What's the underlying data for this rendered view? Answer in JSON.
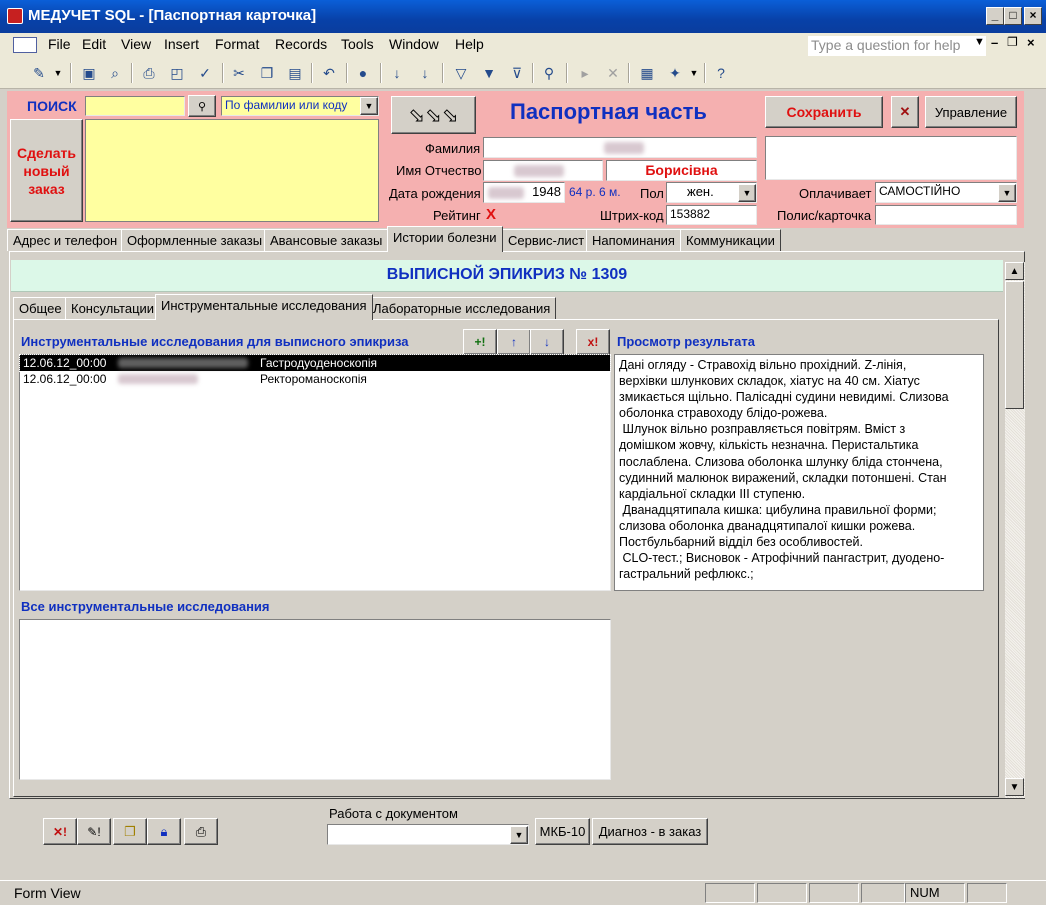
{
  "window": {
    "title": "МЕДУЧЕТ SQL - [Паспортная карточка]"
  },
  "menu": {
    "items": [
      "File",
      "Edit",
      "View",
      "Insert",
      "Format",
      "Records",
      "Tools",
      "Window",
      "Help"
    ],
    "help_placeholder": "Type a question for help"
  },
  "search": {
    "label": "ПОИСК",
    "value": "",
    "mode": "По фамилии или коду"
  },
  "new_order_button": "Сделать новый заказ",
  "header": {
    "title": "Паспортная часть",
    "save": "Сохранить",
    "manage": "Управление"
  },
  "form": {
    "surname_label": "Фамилия",
    "name_label": "Имя Отчество",
    "patronymic": "Борисівна",
    "dob_label": "Дата рождения",
    "dob_year": "1948",
    "age": "64 р. 6 м.",
    "sex_label": "Пол",
    "sex_value": "жен.",
    "payer_label": "Оплачивает",
    "payer_value": "САМОСТІЙНО",
    "rating_label": "Рейтинг",
    "rating_value": "X",
    "barcode_label": "Штрих-код",
    "barcode_value": "153882",
    "policy_label": "Полис/карточка",
    "policy_value": ""
  },
  "main_tabs": [
    "Адрес и телефон",
    "Оформленные заказы",
    "Авансовые заказы",
    "Истории болезни",
    "Сервис-лист",
    "Напоминания",
    "Коммуникации"
  ],
  "active_main_tab": "Истории болезни",
  "epicrisis_title": "ВЫПИСНОЙ ЭПИКРИЗ № 1309",
  "sub_tabs": [
    "Общее",
    "Консультации",
    "Инструментальные исследования",
    "Лабораторные исследования"
  ],
  "active_sub_tab": "Инструментальные исследования",
  "instrumental": {
    "list_label": "Инструментальные исследования для выписного эпикриза",
    "rows": [
      {
        "date": "12.06.12_00:00",
        "name": "Гастродуоденоскопія"
      },
      {
        "date": "12.06.12_00:00",
        "name": "Ректороманоскопія"
      }
    ],
    "result_label": "Просмотр результата",
    "result_text": "Дані огляду - Стравохід вільно прохідний. Z-лінія,\nверхівки шлункових складок, хіатус на 40 см. Хіатус\nзмикається щільно. Палісадні судини невидимі. Слизова\nоболонка стравоходу блідо-рожева.\n Шлунок вільно розправляється повітрям. Вміст з\nдомішком жовчу, кількість незначна. Перистальтика\nпослаблена. Слизова оболонка шлунку бліда стончена,\nсудинний малюнок виражений, складки потоншені. Стан\nкардіальної складки ІІІ ступеню.\n Дванадцятипала кишка: цибулина правильної форми;\nслизова оболонка дванадцятипалої кишки рожева.\nПостбульбарний відділ без особливостей.\n CLO-тест.; Висновок - Атрофічний пангастрит, дуодено-\nгастральний рефлюкс.;",
    "all_label": "Все инструментальные исследования",
    "btn_add": "+!",
    "btn_del": "x!"
  },
  "bottom": {
    "doc_label": "Работа с документом",
    "doc_value": "",
    "mkb": "МКБ-10",
    "diag": "Диагноз - в заказ"
  },
  "status": {
    "left": "Form View",
    "num": "NUM"
  }
}
